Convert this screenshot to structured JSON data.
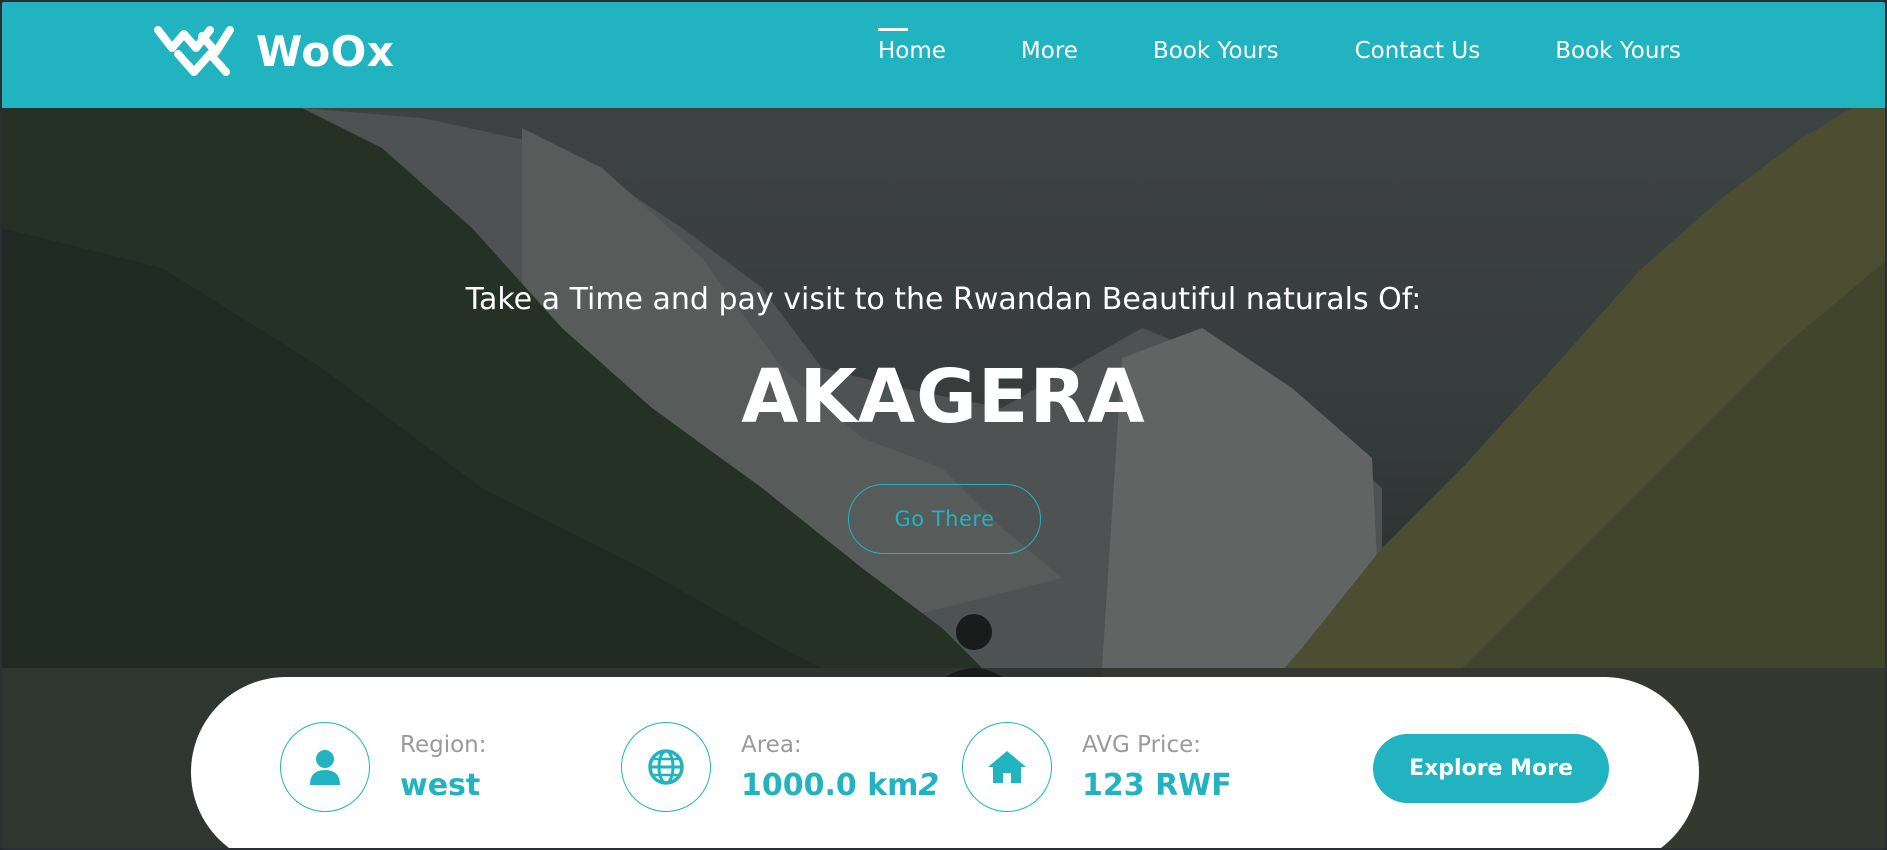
{
  "brand": {
    "name": "WoOx"
  },
  "nav": {
    "items": [
      "Home",
      "More",
      "Book Yours",
      "Contact Us",
      "Book Yours"
    ],
    "active": "Home"
  },
  "hero": {
    "tagline": "Take a Time and pay visit to the Rwandan Beautiful naturals Of:",
    "title": "AKAGERA",
    "cta": "Go There"
  },
  "info": {
    "region": {
      "label": "Region:",
      "value": "west",
      "icon": "user-icon"
    },
    "area": {
      "label": "Area:",
      "value": "1000.0 km",
      "unit_suffix": "2",
      "icon": "globe-icon"
    },
    "price": {
      "label": "AVG Price:",
      "value": "123 RWF",
      "icon": "home-icon"
    },
    "explore": "Explore More"
  },
  "colors": {
    "accent": "#22b3c1",
    "white": "#ffffff",
    "label_gray": "#9a9a9a"
  }
}
